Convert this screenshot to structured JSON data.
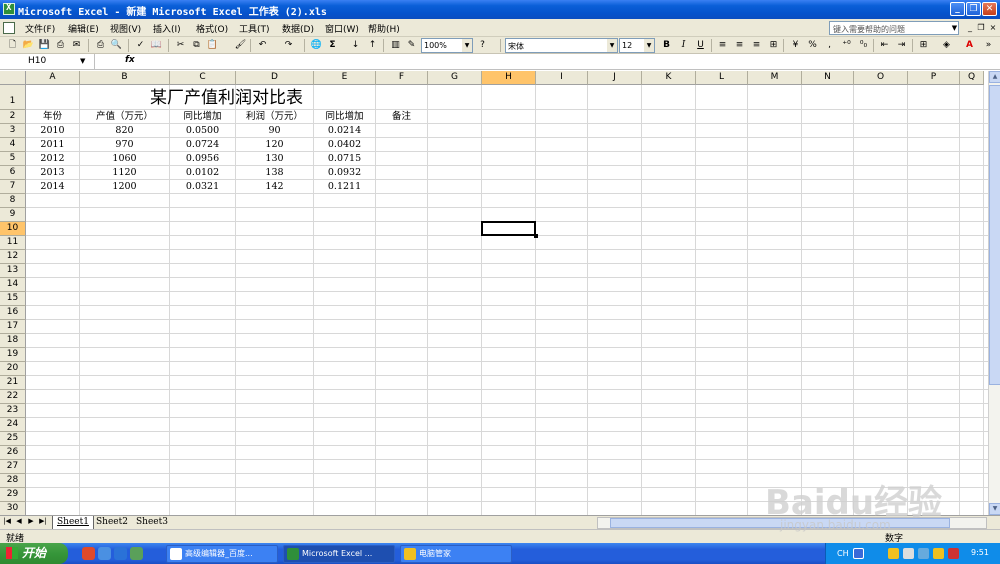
{
  "window": {
    "title": "Microsoft Excel - 新建 Microsoft Excel 工作表 (2).xls",
    "buttons": {
      "minimize": "_",
      "maximize": "❐",
      "close": "✕"
    }
  },
  "menu": {
    "items": [
      "文件(F)",
      "编辑(E)",
      "视图(V)",
      "插入(I)",
      "格式(O)",
      "工具(T)",
      "数据(D)",
      "窗口(W)",
      "帮助(H)"
    ],
    "help_placeholder": "键入需要帮助的问题"
  },
  "toolbar": {
    "zoom": "100%",
    "font_name": "宋体",
    "font_size": "12",
    "bold": "B",
    "italic": "I",
    "underline": "U",
    "sum": "Σ",
    "percent": "%"
  },
  "formula_bar": {
    "name_box": "H10",
    "fx": "fx",
    "formula": ""
  },
  "columns": [
    "A",
    "B",
    "C",
    "D",
    "E",
    "F",
    "G",
    "H",
    "I",
    "J",
    "K",
    "L",
    "M",
    "N",
    "O",
    "P",
    "Q"
  ],
  "rows": [
    "1",
    "2",
    "3",
    "4",
    "5",
    "6",
    "7",
    "8",
    "9",
    "10",
    "11",
    "12",
    "13",
    "14",
    "15",
    "16",
    "17",
    "18",
    "19",
    "20",
    "21",
    "22",
    "23",
    "24",
    "25",
    "26",
    "27",
    "28",
    "29",
    "30"
  ],
  "active_cell": "H10",
  "sheet": {
    "title": "某厂产值利润对比表",
    "headers": [
      "年份",
      "产值（万元）",
      "同比增加",
      "利润（万元）",
      "同比增加",
      "备注"
    ],
    "data": [
      [
        "2010",
        "820",
        "0.0500",
        "90",
        "0.0214"
      ],
      [
        "2011",
        "970",
        "0.0724",
        "120",
        "0.0402"
      ],
      [
        "2012",
        "1060",
        "0.0956",
        "130",
        "0.0715"
      ],
      [
        "2013",
        "1120",
        "0.0102",
        "138",
        "0.0932"
      ],
      [
        "2014",
        "1200",
        "0.0321",
        "142",
        "0.1211"
      ]
    ]
  },
  "sheet_tabs": [
    "Sheet1",
    "Sheet2",
    "Sheet3"
  ],
  "active_sheet": "Sheet1",
  "status": {
    "left": "就绪",
    "mode": "数字"
  },
  "taskbar": {
    "start": "开始",
    "items": [
      "高级编辑器_百度...",
      "Microsoft Excel ...",
      "电脑管家"
    ],
    "lang": "CH",
    "clock": "9:51"
  },
  "watermark": {
    "main": "Baidu经验",
    "sub": "jingyan.baidu.com"
  }
}
